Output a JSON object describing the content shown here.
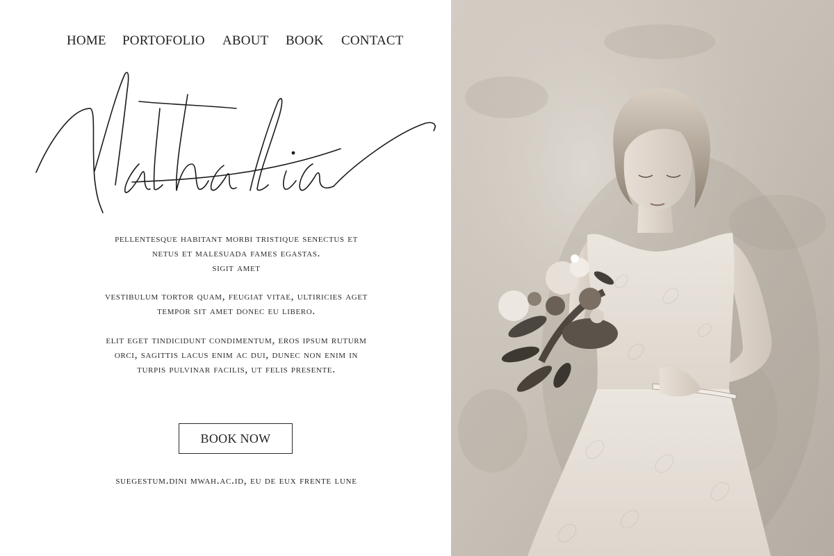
{
  "nav": {
    "items": [
      {
        "label": "HOME"
      },
      {
        "label": "PORTOFOLIO"
      },
      {
        "label": "ABOUT"
      },
      {
        "label": "BOOK"
      },
      {
        "label": "CONTACT"
      }
    ]
  },
  "hero": {
    "script_title": "Nathalia"
  },
  "content": {
    "paragraph_1_line_1": "Pellentesque habitant morbi tristique senectus et",
    "paragraph_1_line_2": "netus et malesuada fames egastas.",
    "paragraph_1_line_3": "sigit amet",
    "paragraph_2_line_1": "Vestibulum tortor quam, feugiat vitae, ultiricies aget",
    "paragraph_2_line_2": "tempor sit amet donec eu libero.",
    "paragraph_3_line_1": "Elit eget tindicidunt condimentum, eros ipsum ruturm",
    "paragraph_3_line_2": "orci, sagittis lacus enim ac dui, dunec non enim in",
    "paragraph_3_line_3": "turpis pulvinar facilis, ut felis presente."
  },
  "cta": {
    "book_now_label": "BOOK NOW"
  },
  "footer": {
    "line": "suegestum.dini mwah.ac.id, eu de eux frente lune"
  },
  "colors": {
    "background": "#ffffff",
    "text": "#222222",
    "photo_wall": "#c9c2b9"
  }
}
